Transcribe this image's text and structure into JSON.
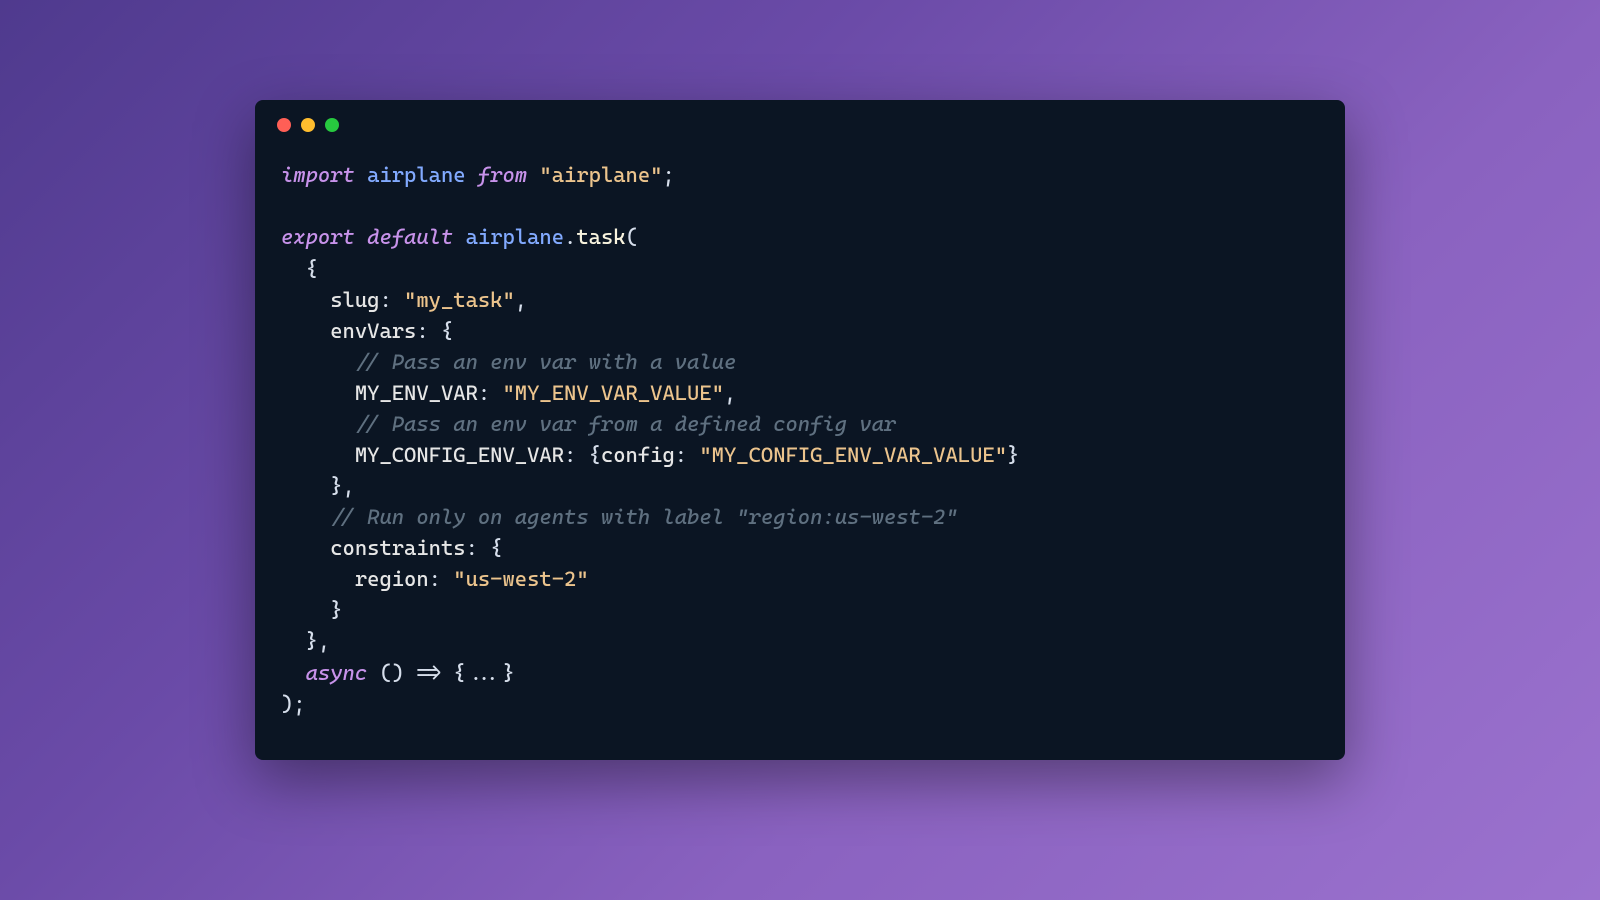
{
  "window": {
    "traffic_lights": [
      "close",
      "minimize",
      "zoom"
    ]
  },
  "code": {
    "line1": {
      "import_kw": "import",
      "module": "airplane",
      "from_kw": "from",
      "source": "\"airplane\"",
      "semi": ";"
    },
    "line2": {
      "export_kw": "export",
      "default_kw": "default",
      "ident": "airplane",
      "dot": ".",
      "method": "task",
      "open": "("
    },
    "line3": {
      "brace": "  {"
    },
    "line4": {
      "indent": "    ",
      "key": "slug",
      "colon": ": ",
      "value": "\"my_task\"",
      "comma": ","
    },
    "line5": {
      "indent": "    ",
      "key": "envVars",
      "rest": ": {"
    },
    "line6": {
      "comment": "      // Pass an env var with a value"
    },
    "line7": {
      "indent": "      ",
      "key": "MY_ENV_VAR",
      "colon": ": ",
      "value": "\"MY_ENV_VAR_VALUE\"",
      "comma": ","
    },
    "line8": {
      "comment": "      // Pass an env var from a defined config var"
    },
    "line9": {
      "indent": "      ",
      "key": "MY_CONFIG_ENV_VAR",
      "colon": ": {",
      "config_key": "config",
      "colon2": ": ",
      "value": "\"MY_CONFIG_ENV_VAR_VALUE\"",
      "close": "}"
    },
    "line10": {
      "text": "    },"
    },
    "line11": {
      "comment": "    // Run only on agents with label \"region:us-west-2\""
    },
    "line12": {
      "indent": "    ",
      "key": "constraints",
      "rest": ": {"
    },
    "line13": {
      "indent": "      ",
      "key": "region",
      "colon": ": ",
      "value": "\"us-west-2\""
    },
    "line14": {
      "text": "    }"
    },
    "line15": {
      "text": "  },"
    },
    "line16": {
      "indent": "  ",
      "async_kw": "async",
      "rest": " () => {...}"
    },
    "line17": {
      "text": ");"
    }
  }
}
